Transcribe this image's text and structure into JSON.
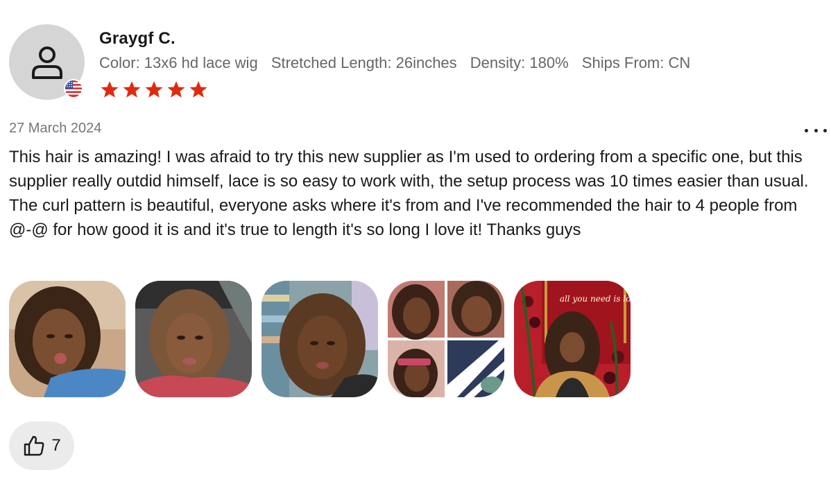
{
  "reviewer": {
    "name": "Graygf C.",
    "country_flag": "us-flag-icon",
    "avatar": "user-icon"
  },
  "attributes": [
    "Color: 13x6 hd lace wig",
    "Stretched Length: 26inches",
    "Density: 180%",
    "Ships From: CN"
  ],
  "rating": {
    "value": 5,
    "max": 5,
    "color": "#e02a0e"
  },
  "date": "27 March 2024",
  "review_text": "This hair is amazing! I was afraid to try this new supplier as I'm used to ordering from a specific one, but this supplier really outdid himself, lace is so easy to work with, the setup process was 10 times easier than usual. The curl pattern is beautiful, everyone asks where it's from and I've recommended the hair to 4 people from @-@ for how good it is and it's true to length it's so long I love it! Thanks guys",
  "photo_sign_text": "all you need is love",
  "helpful": {
    "icon": "thumbs-up-icon",
    "count": "7"
  }
}
